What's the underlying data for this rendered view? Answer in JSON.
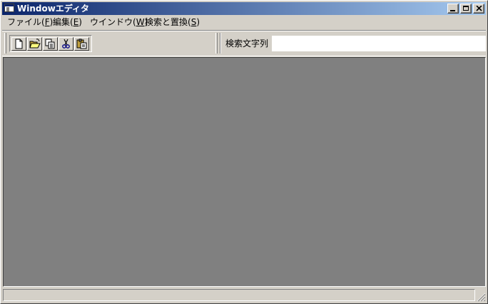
{
  "window": {
    "title": "Windowエディタ"
  },
  "menu": {
    "items": [
      {
        "label": "ファイル(",
        "key": "F",
        "suffix": ")"
      },
      {
        "label": "編集(",
        "key": "E",
        "suffix": ")"
      },
      {
        "label": "ウインドウ(",
        "key": "W",
        "suffix": ")"
      },
      {
        "label": "検索と置換(",
        "key": "S",
        "suffix": ")"
      }
    ]
  },
  "toolbar": {
    "buttons": [
      {
        "icon": "new-document-icon"
      },
      {
        "icon": "open-folder-icon"
      },
      {
        "icon": "copy-icon"
      },
      {
        "icon": "cut-icon"
      },
      {
        "icon": "paste-icon"
      }
    ]
  },
  "search": {
    "label": "検索文字列",
    "value": ""
  },
  "status": {
    "text": ""
  },
  "colors": {
    "title_start": "#0a246a",
    "title_end": "#a6caf0",
    "face": "#d4d0c8",
    "mdi_background": "#808080"
  }
}
